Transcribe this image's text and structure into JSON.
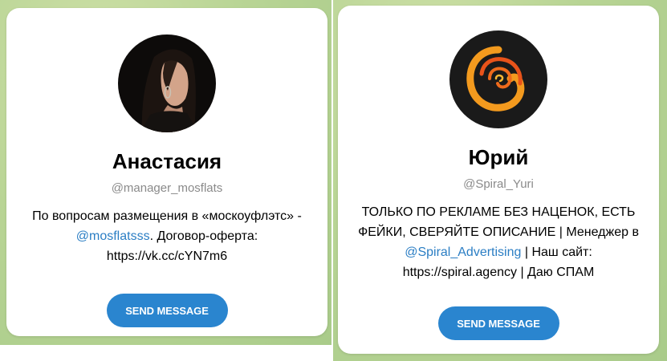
{
  "left_profile": {
    "name": "Анастасия",
    "username": "@manager_mosflats",
    "bio_text_1": "По вопросам размещения в «москоуфлэтс» -",
    "bio_mention": "@mosflatsss",
    "bio_text_2": ". Договор-оферта:",
    "bio_text_3": "https://vk.cc/cYN7m6",
    "button_label": "SEND MESSAGE"
  },
  "right_profile": {
    "name": "Юрий",
    "username": "@Spiral_Yuri",
    "bio_text_1": "ТОЛЬКО ПО РЕКЛАМЕ БЕЗ НАЦЕНОК, ЕСТЬ",
    "bio_text_2": "ФЕЙКИ, СВЕРЯЙТЕ ОПИСАНИЕ | Менеджер в",
    "bio_mention": "@Spiral_Advertising",
    "bio_text_3": " | Наш сайт:",
    "bio_text_4": "https://spiral.agency | Даю СПАМ",
    "button_label": "SEND MESSAGE"
  },
  "colors": {
    "accent": "#2a85cf",
    "link": "#2b7ec4",
    "background": "#b9d595"
  }
}
